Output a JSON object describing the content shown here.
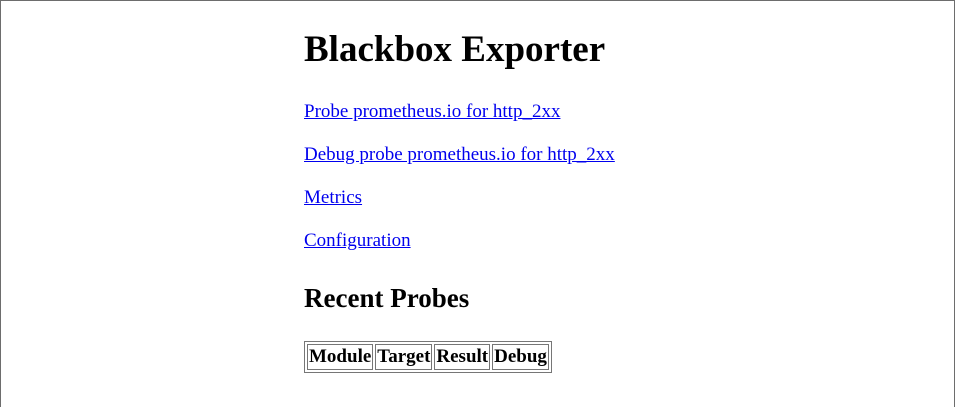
{
  "page": {
    "title": "Blackbox Exporter",
    "links": [
      {
        "label": "Probe prometheus.io for http_2xx"
      },
      {
        "label": "Debug probe prometheus.io for http_2xx"
      },
      {
        "label": "Metrics"
      },
      {
        "label": "Configuration"
      }
    ],
    "recent_probes_heading": "Recent Probes",
    "table": {
      "headers": [
        "Module",
        "Target",
        "Result",
        "Debug"
      ],
      "rows": []
    }
  },
  "colors": {
    "link": "#0000ee",
    "text": "#000000",
    "background": "#ffffff"
  }
}
